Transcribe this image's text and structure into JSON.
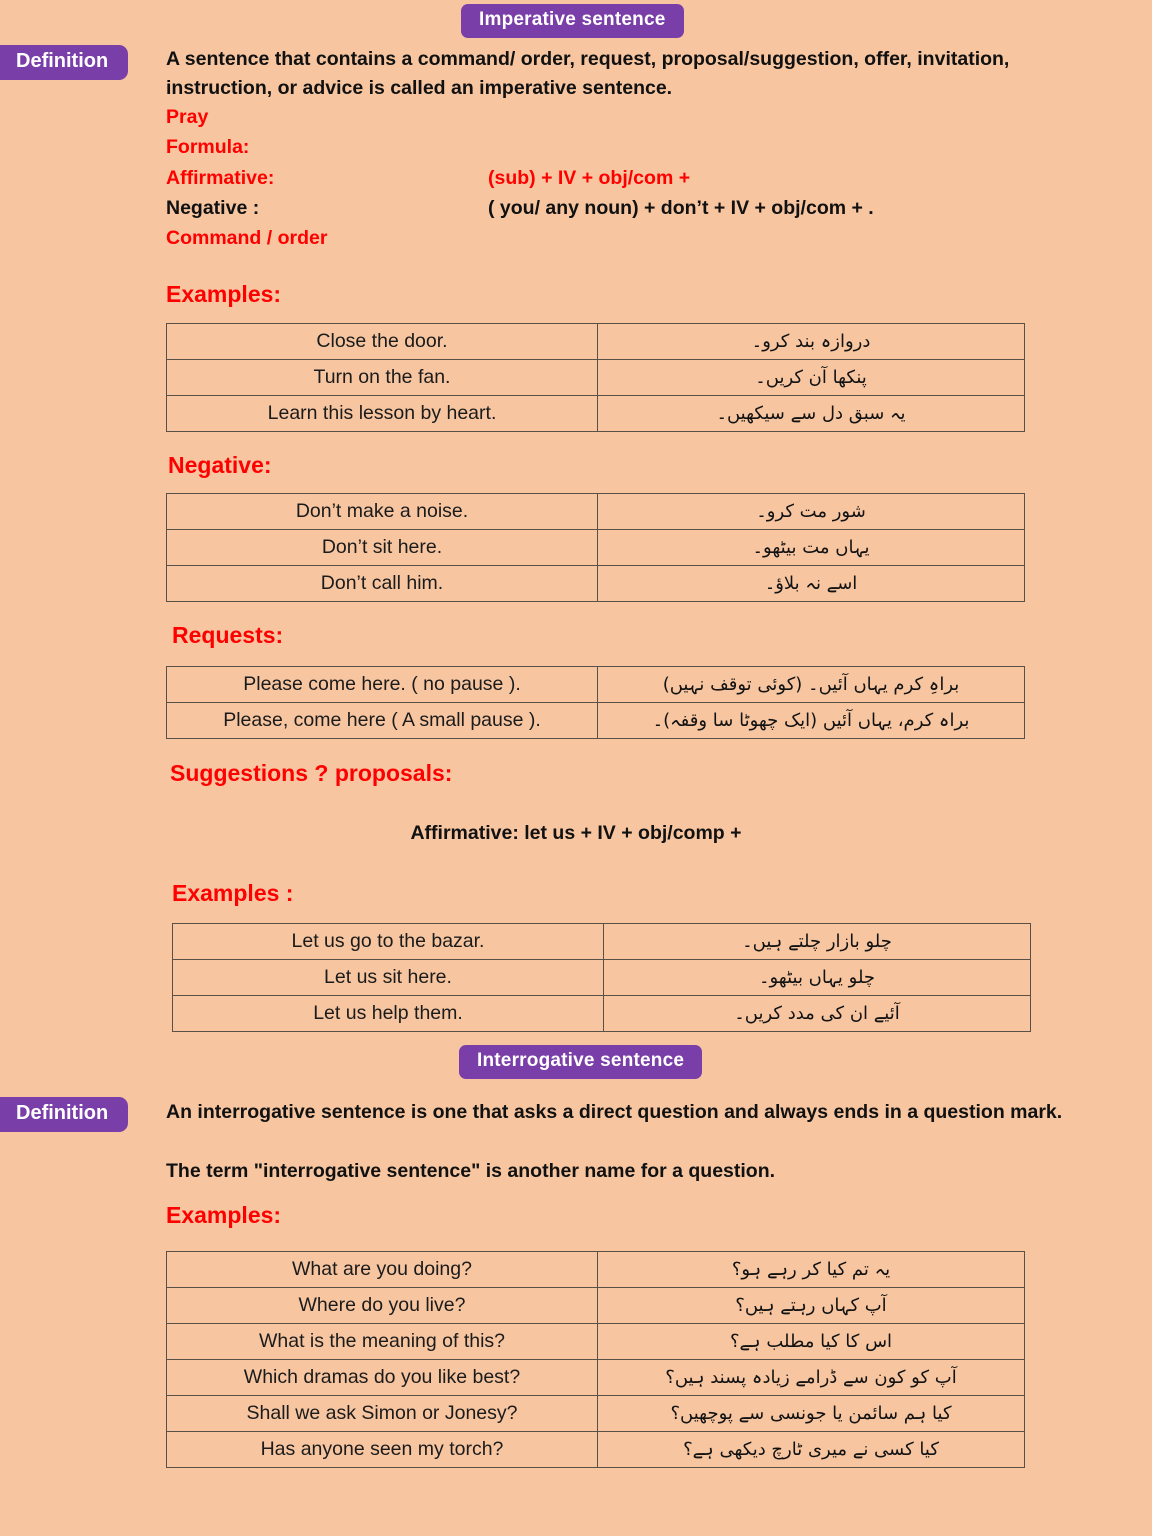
{
  "imperative": {
    "section_title": "Imperative sentence",
    "definition_label": "Definition",
    "definition_text": "A sentence that contains a command/ order, request, proposal/suggestion, offer, invitation, instruction, or advice is called an imperative sentence.",
    "pray": "Pray",
    "formula_label": "Formula:",
    "affirmative_label": "Affirmative:",
    "affirmative_value": "(sub) + IV + obj/com +",
    "negative_label": "Negative :",
    "negative_value": "( you/ any noun) + don’t + IV + obj/com + .",
    "command_order": "Command / order",
    "examples_heading": "Examples:",
    "examples": [
      {
        "english": "Close the door.",
        "urdu": "دروازہ بند کرو۔"
      },
      {
        "english": "Turn on the fan.",
        "urdu": "پنکھا آن کریں۔"
      },
      {
        "english": "Learn this lesson by heart.",
        "urdu": "یہ سبق دل سے سیکھیں۔"
      }
    ],
    "negative_heading": "Negative:",
    "negative_examples": [
      {
        "english": "Don’t make a noise.",
        "urdu": "شور مت کرو۔"
      },
      {
        "english": "Don’t sit here.",
        "urdu": "یہاں مت بیٹھو۔"
      },
      {
        "english": "Don’t call him.",
        "urdu": "اسے نہ بلاؤ۔"
      }
    ],
    "requests_heading": "Requests:",
    "requests_examples": [
      {
        "english": "Please come here. ( no pause ).",
        "urdu": "براہِ کرم یہاں آئیں۔ (کوئی توقف نہیں)"
      },
      {
        "english": "Please, come here (  A small pause ).",
        "urdu": "براہ کرم، یہاں آئیں (ایک چھوٹا سا وقفہ)۔"
      }
    ],
    "suggestions_heading": "Suggestions ? proposals:",
    "suggestions_formula": "Affirmative: let us + IV + obj/comp +",
    "suggestions_examples_heading": "Examples :",
    "suggestions_examples": [
      {
        "english": "Let us go to the  bazar.",
        "urdu": "چلو بازار چلتے ہیں۔"
      },
      {
        "english": "Let us sit here.",
        "urdu": "چلو یہاں بیٹھو۔"
      },
      {
        "english": "Let us help them.",
        "urdu": "آئیے ان کی مدد کریں۔"
      }
    ]
  },
  "interrogative": {
    "section_title": "Interrogative sentence",
    "definition_label": "Definition",
    "definition_text_line1": "An interrogative sentence is one that asks a direct question and always ends in a question mark.",
    "definition_text_line2": "The term \"interrogative sentence\" is another name for a question.",
    "examples_heading": "Examples:",
    "examples": [
      {
        "english": "What are you doing?",
        "urdu": "یہ تم کیا کر رہے ہو؟"
      },
      {
        "english": "Where do you live?",
        "urdu": "آپ کہاں رہتے ہیں؟"
      },
      {
        "english": "What is the meaning of this?",
        "urdu": "اس کا کیا مطلب ہے؟"
      },
      {
        "english": "Which dramas do you like best?",
        "urdu": "آپ کو کون سے ڈرامے زیادہ پسند ہیں؟"
      },
      {
        "english": "Shall we ask Simon or Jonesy?",
        "urdu": "کیا ہم سائمن یا جونسی سے پوچھیں؟"
      },
      {
        "english": "Has anyone seen my torch?",
        "urdu": "کیا کسی نے میری ٹارچ دیکھی ہے؟"
      }
    ]
  }
}
